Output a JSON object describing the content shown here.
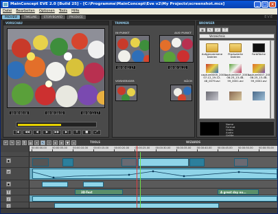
{
  "window": {
    "title": "MainConcept EVE 2.0 [Build 25] - [C:\\Programme\\MainConcept\\Eve v2\\My Projects\\screenshot.mcs]",
    "controls": [
      "minimize",
      "maximize",
      "close"
    ]
  },
  "menu": [
    "Datei",
    "Bearbeiten",
    "Optionen",
    "Tools",
    "Hilfe"
  ],
  "top_tabs": [
    {
      "label": "PREVIEW",
      "active": true
    },
    {
      "label": "TIMELINE",
      "active": false
    },
    {
      "label": "STORYBOARD",
      "active": false
    },
    {
      "label": "PRODUCE",
      "active": false
    }
  ],
  "brand": "EVE",
  "preview": {
    "header": "VORSCHAU",
    "timecode_left": "00:00:00.00",
    "timecode_mid": "00:00:28.03",
    "timecode_right": "00:00:13.17",
    "progress": 0.55,
    "controls": [
      "|◀",
      "◀◀",
      "◀",
      "▶",
      "▶▶",
      "▶|",
      "II",
      "■",
      "⤢"
    ]
  },
  "trimmer": {
    "header": "TRIMMER",
    "in_label": "IN-PUNKT",
    "out_label": "AUS-PUNKT",
    "in_timecode": "00:00:02.17",
    "out_timecode": "00:00:16.21",
    "prev_label": "VORHERIGER",
    "next_label": "NÄCH"
  },
  "browser": {
    "header": "BROWSER",
    "tabs": [
      "▦",
      "✎",
      "♪",
      "T"
    ],
    "path": "Verzeichnis",
    "items": [
      {
        "name": "Aufgenommene Dateien",
        "type": "folder"
      },
      {
        "name": "Produzierte Dateien",
        "type": "folder"
      },
      {
        "name": "Farbfläche",
        "type": "color"
      },
      {
        "name": "capture0005_2003-07-12_19-12-48_0079.avi",
        "type": "thumb"
      },
      {
        "name": "capture0007_2003-08-25_13-48-59_0001.avi",
        "type": "thumb"
      },
      {
        "name": "capture0007_2003-08-25_13-48-59_0002.avi",
        "type": "thumb"
      },
      {
        "name": "",
        "type": "thumb"
      },
      {
        "name": "",
        "type": "thumb"
      },
      {
        "name": "",
        "type": "thumb"
      }
    ],
    "info_lines": [
      "Name",
      "Format",
      "Video",
      "Audio",
      "Größe"
    ]
  },
  "tools": {
    "label": "TOOLS",
    "wizard_label": "WIZARDS"
  },
  "timeline": {
    "ruler": [
      "00:00:00.00",
      "00:00:05.00",
      "00:00:10.00",
      "00:00:15.00",
      "00:00:20.00",
      "00:00:25.00",
      "00:00:30.00",
      "00:00:35.00",
      "00:00:40.00",
      "00:00:45.00",
      "00:00:50.00",
      "00:00:55.00"
    ],
    "title_clips": [
      "3D-Text",
      "A great day ou..."
    ]
  }
}
